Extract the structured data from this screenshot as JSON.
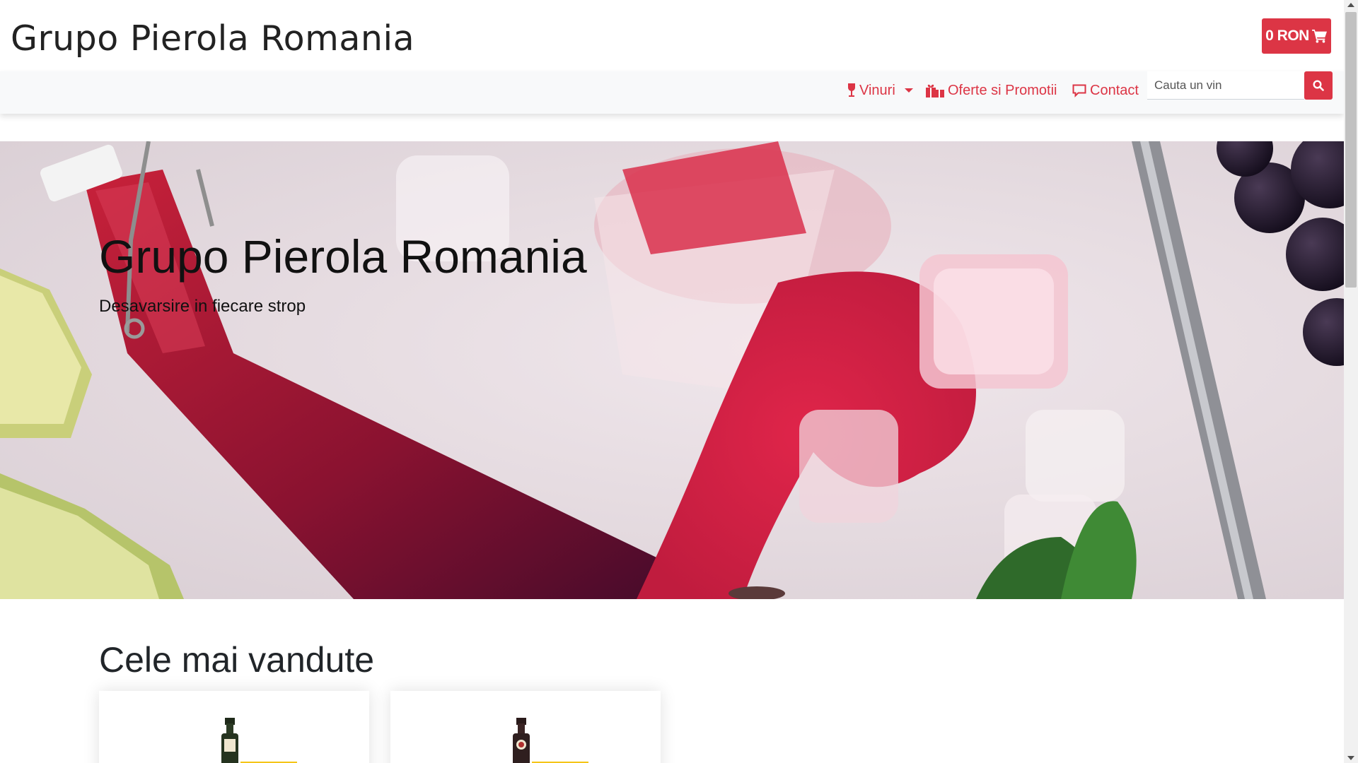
{
  "header": {
    "brand": "Grupo Pierola Romania",
    "cart_label": "0 RON"
  },
  "nav": {
    "vinuri": "Vinuri",
    "oferte": "Oferte si Promotii",
    "contact": "Contact",
    "search_placeholder": "Cauta un vin"
  },
  "hero": {
    "title": "Grupo Pierola Romania",
    "subtitle": "Desavarsire in fiecare strop"
  },
  "best_sellers": {
    "title": "Cele mai vandute"
  },
  "colors": {
    "accent": "#dc3545",
    "navbar_bg": "#f8f9fa"
  },
  "icons": {
    "cart": "shopping-cart-icon",
    "vinuri": "wine-glass-icon",
    "oferte": "gifts-icon",
    "contact": "comment-icon",
    "search": "search-icon"
  }
}
